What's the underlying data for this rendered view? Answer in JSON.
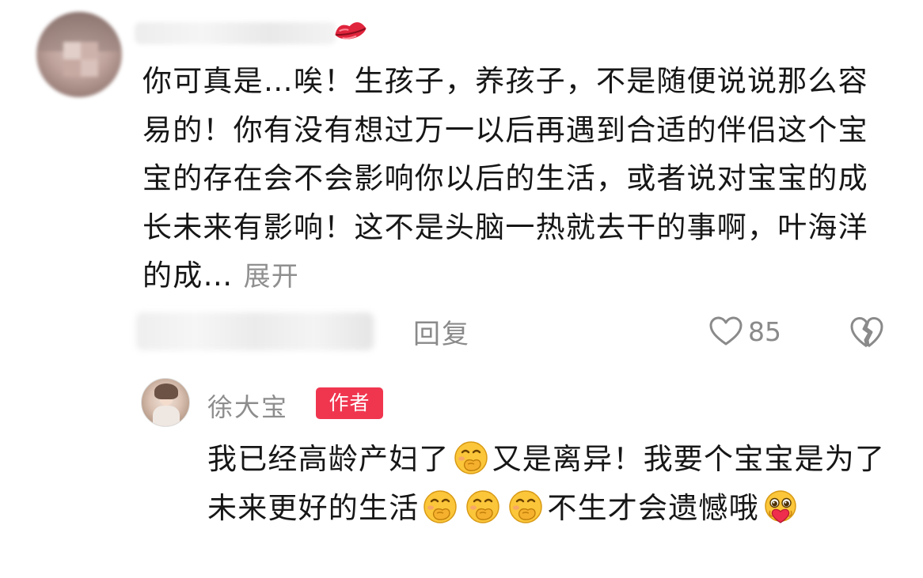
{
  "comment": {
    "text": "你可真是…唉！生孩子，养孩子，不是随便说说那么容易的！你有没有想过万一以后再遇到合适的伴侣这个宝宝的存在会不会影响你以后的生活，或者说对宝宝的成长未来有影响！这不是头脑一热就去干的事啊，叶海洋的成…",
    "expand_label": "展开",
    "reply_label": "回复",
    "like_count": "85",
    "icons": [
      "lips-icon",
      "heart-outline-icon",
      "broken-heart-icon"
    ]
  },
  "reply": {
    "author": "徐大宝",
    "badge": "作者",
    "text_part1": "我已经高龄产妇了",
    "text_part2": "又是离异！我要个宝宝是为了未来更好的生活",
    "text_part3": "不生才会遗憾哦",
    "icons": [
      "covering-mouth-emoji-icon",
      "pleading-heart-emoji-icon"
    ]
  },
  "colors": {
    "badge": "#f0364f",
    "muted_text": "#8a8a8a",
    "body_text": "#161616",
    "lips": "#e0243c",
    "emoji_yellow": "#fbc63a"
  }
}
